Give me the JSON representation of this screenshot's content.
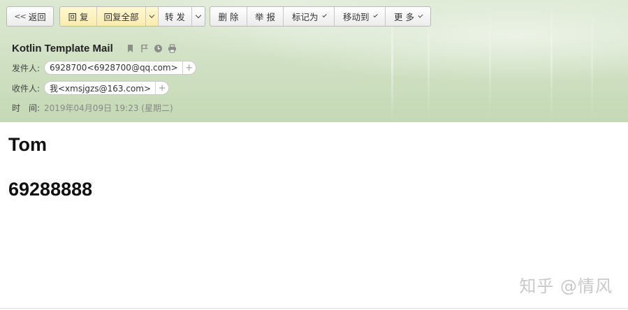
{
  "toolbar": {
    "back_label": "返回",
    "reply_label": "回 复",
    "reply_all_label": "回复全部",
    "forward_label": "转 发",
    "delete_label": "删 除",
    "report_label": "举 报",
    "mark_as_label": "标记为",
    "move_to_label": "移动到",
    "more_label": "更 多"
  },
  "mail": {
    "subject": "Kotlin Template Mail",
    "from_label": "发件人:",
    "from_value": "6928700<6928700@qq.com>",
    "to_label": "收件人:",
    "to_value": "我<xmsjgzs@163.com>",
    "time_label": "时　间:",
    "time_value": "2019年04月09日 19:23 (星期二)",
    "add_symbol": "+"
  },
  "content": {
    "line1": "Tom",
    "line2": "69288888"
  },
  "watermark": "知乎 @情风",
  "colors": {
    "header_bg": "#cfe0c2",
    "reply_btn_bg": "#fbecae",
    "text": "#222222"
  }
}
